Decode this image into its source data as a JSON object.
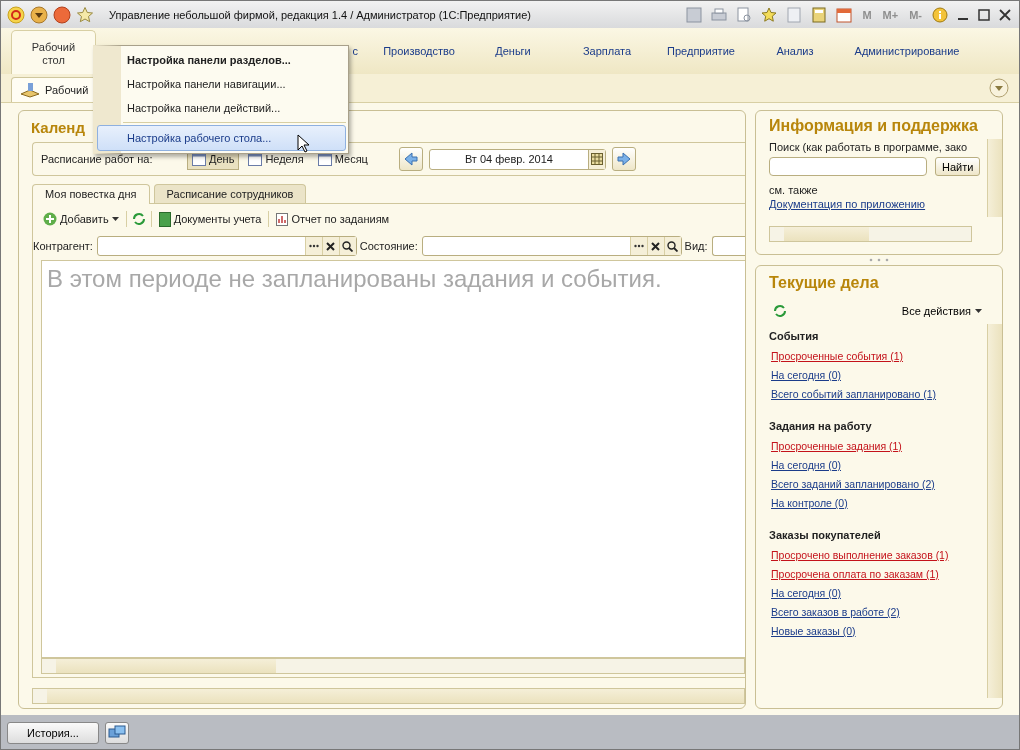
{
  "window": {
    "title": "Управление небольшой фирмой, редакция 1.4 / Администратор  (1С:Предприятие)",
    "toolbar": [
      "M",
      "M+",
      "M-"
    ]
  },
  "sections": [
    {
      "label": "Рабочий\nстол",
      "selected": true
    },
    {
      "label": "с",
      "selected": false
    },
    {
      "label": "Производство",
      "selected": false
    },
    {
      "label": "Деньги",
      "selected": false
    },
    {
      "label": "Зарплата",
      "selected": false
    },
    {
      "label": "Предприятие",
      "selected": false
    },
    {
      "label": "Анализ",
      "selected": false
    },
    {
      "label": "Администрирование",
      "selected": false
    }
  ],
  "open_tabs": [
    {
      "label": "Рабочий",
      "selected": true
    }
  ],
  "menu": [
    {
      "label": "Настройка панели разделов...",
      "bold": true,
      "selected": false
    },
    {
      "label": "Настройка панели навигации...",
      "bold": false,
      "selected": false
    },
    {
      "label": "Настройка панели действий...",
      "bold": false,
      "selected": false
    },
    {
      "label": "Настройка рабочего стола...",
      "bold": false,
      "selected": true
    }
  ],
  "calendar": {
    "title": "Календ",
    "schedule_label": "Расписание работ на:",
    "periods": [
      {
        "label": "День",
        "selected": true
      },
      {
        "label": "Неделя",
        "selected": false
      },
      {
        "label": "Месяц",
        "selected": false
      }
    ],
    "date": "Вт 04 февр. 2014",
    "tabs": [
      {
        "label": "Моя повестка дня",
        "selected": true
      },
      {
        "label": "Расписание сотрудников",
        "selected": false
      }
    ],
    "actions": {
      "add": "Добавить",
      "documents": "Документы учета",
      "report": "Отчет по заданиям"
    },
    "filters": [
      {
        "label": "Контрагент:"
      },
      {
        "label": "Состояние:"
      },
      {
        "label": "Вид:"
      }
    ],
    "empty_message": "В этом периоде не запланированы задания и события."
  },
  "info": {
    "title": "Информация и поддержка",
    "search_label": "Поиск (как работать в программе, зако",
    "find_button": "Найти",
    "see_also": "см. также",
    "doc_link": "Документация по приложению"
  },
  "tasks": {
    "title": "Текущие дела",
    "all_actions": "Все действия",
    "groups": [
      {
        "title": "События",
        "links": [
          {
            "label": "Просроченные события (1)",
            "overdue": true
          },
          {
            "label": "На сегодня (0)",
            "overdue": false
          },
          {
            "label": "Всего событий запланировано (1)",
            "overdue": false
          }
        ]
      },
      {
        "title": "Задания на работу",
        "links": [
          {
            "label": "Просроченные задания (1)",
            "overdue": true
          },
          {
            "label": "На сегодня (0)",
            "overdue": false
          },
          {
            "label": "Всего заданий запланировано (2)",
            "overdue": false
          },
          {
            "label": "На контроле (0)",
            "overdue": false
          }
        ]
      },
      {
        "title": "Заказы покупателей",
        "links": [
          {
            "label": "Просрочено выполнение заказов (1)",
            "overdue": true
          },
          {
            "label": "Просрочена оплата по заказам (1)",
            "overdue": true
          },
          {
            "label": "На сегодня (0)",
            "overdue": false
          },
          {
            "label": "Всего заказов в работе (2)",
            "overdue": false
          },
          {
            "label": "Новые заказы (0)",
            "overdue": false
          }
        ]
      }
    ]
  },
  "bottom": {
    "history_button": "История..."
  }
}
